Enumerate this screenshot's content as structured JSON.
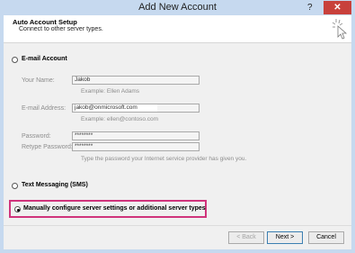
{
  "window": {
    "title": "Add New Account",
    "help": "?",
    "close": "✕"
  },
  "header": {
    "title": "Auto Account Setup",
    "subtitle": "Connect to other server types."
  },
  "email_option": {
    "label": "E-mail Account",
    "your_name_label": "Your Name:",
    "your_name_value": "Jakob",
    "your_name_hint": "Example: Ellen Adams",
    "email_label": "E-mail Address:",
    "email_value": "jakob@onmicrosoft.com",
    "email_hint": "Example: ellen@contoso.com",
    "password_label": "Password:",
    "password_value": "********",
    "retype_label": "Retype Password:",
    "retype_value": "********",
    "password_hint": "Type the password your Internet service provider has given you."
  },
  "sms_option": {
    "label": "Text Messaging (SMS)"
  },
  "manual_option": {
    "label": "Manually configure server settings or additional server types",
    "selected": true
  },
  "buttons": {
    "back": "< Back",
    "next": "Next >",
    "cancel": "Cancel"
  },
  "colors": {
    "titlebar": "#c6d9ef",
    "close": "#c8413b",
    "highlight": "#d0347c"
  }
}
